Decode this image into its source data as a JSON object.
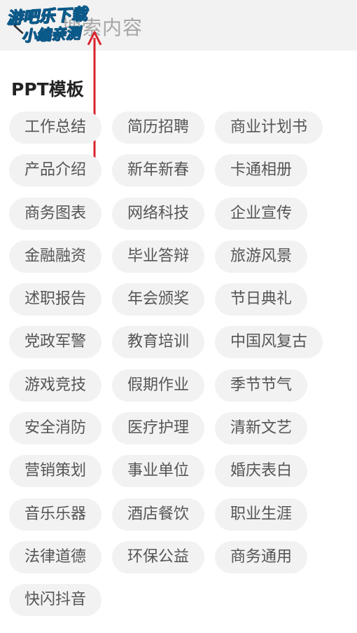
{
  "search": {
    "placeholder": "搜索内容"
  },
  "watermark": {
    "line1": "游吧乐下载",
    "line2": "小编亲测"
  },
  "section": {
    "title": "PPT模板"
  },
  "tags": [
    [
      "工作总结",
      "简历招聘",
      "商业计划书"
    ],
    [
      "产品介绍",
      "新年新春",
      "卡通相册"
    ],
    [
      "商务图表",
      "网络科技",
      "企业宣传"
    ],
    [
      "金融融资",
      "毕业答辩",
      "旅游风景"
    ],
    [
      "述职报告",
      "年会颁奖",
      "节日典礼"
    ],
    [
      "党政军警",
      "教育培训",
      "中国风复古"
    ],
    [
      "游戏竞技",
      "假期作业",
      "季节节气"
    ],
    [
      "安全消防",
      "医疗护理",
      "清新文艺"
    ],
    [
      "营销策划",
      "事业单位",
      "婚庆表白"
    ],
    [
      "音乐乐器",
      "酒店餐饮",
      "职业生涯"
    ],
    [
      "法律道德",
      "环保公益",
      "商务通用"
    ],
    [
      "快闪抖音"
    ]
  ],
  "colors": {
    "tag_bg": "#f2f2f2",
    "tag_text": "#555555",
    "arrow": "#d9232d",
    "watermark": "#33d0ff"
  },
  "icons": {
    "back": "chevron-left-icon",
    "annotation": "red-arrow-icon"
  }
}
